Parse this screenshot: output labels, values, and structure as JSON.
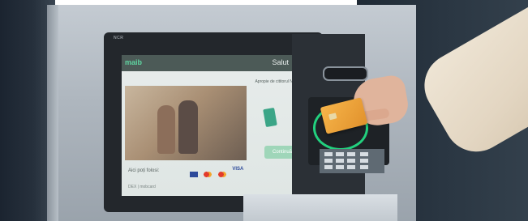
{
  "photo": {
    "subject": "atm-kiosk",
    "screen": {
      "logo": "maib",
      "greeting": "Salut",
      "nfc_text": "Apropie de cititorul NFC",
      "button": "Continuă",
      "pay_text": "Aici poți folosi:",
      "brand_visa": "VISA",
      "footer": "DEX | mobcard"
    },
    "bezel_brand": "NCR",
    "colors": {
      "nfc_ring": "#22d07e",
      "card": "#f7b54a",
      "brand_green": "#5fd3a0"
    }
  }
}
